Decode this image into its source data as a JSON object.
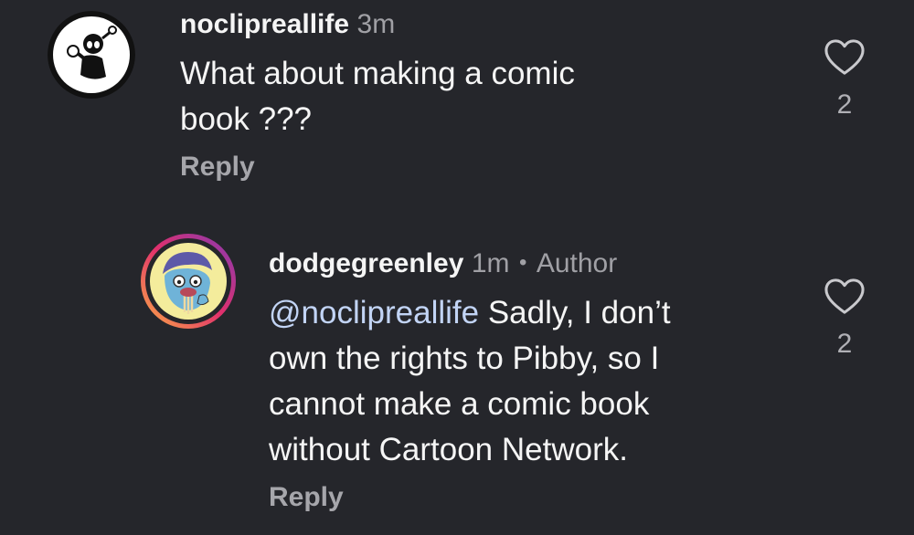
{
  "comments": [
    {
      "username": "noclipreallife",
      "time": "3m",
      "text": "What about making a comic\nbook ???",
      "reply_label": "Reply",
      "like_count": "2",
      "avatar_icon": "cartoon-character-avatar"
    },
    {
      "username": "dodgegreenley",
      "time": "1m",
      "separator": "•",
      "author_badge": "Author",
      "mention": "@noclipreallife",
      "text_first": " Sadly, I don’t",
      "text_rest": "own the rights to Pibby, so I\ncannot make a comic book\nwithout Cartoon Network.",
      "reply_label": "Reply",
      "like_count": "2",
      "avatar_icon": "blue-face-avatar",
      "story_ring_colors": [
        "#fcaf45",
        "#e1306c",
        "#833ab4"
      ]
    }
  ],
  "colors": {
    "background": "#25262b",
    "mention": "#c2d4f5"
  }
}
